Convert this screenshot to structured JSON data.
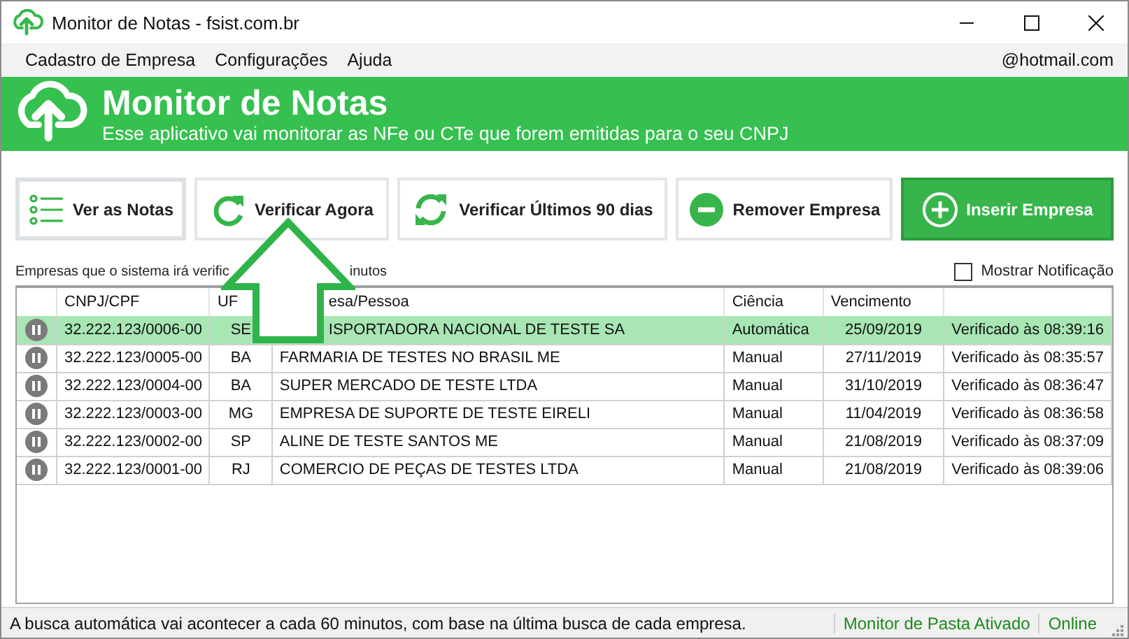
{
  "window": {
    "title": "Monitor de Notas - fsist.com.br"
  },
  "menu": {
    "items": [
      "Cadastro de Empresa",
      "Configurações",
      "Ajuda"
    ],
    "account": "@hotmail.com"
  },
  "banner": {
    "title": "Monitor de Notas",
    "subtitle": "Esse aplicativo vai monitorar as NFe ou CTe que forem emitidas para o seu CNPJ"
  },
  "buttons": [
    {
      "label": "Ver as Notas",
      "kind": "list",
      "primary": false
    },
    {
      "label": "Verificar Agora",
      "kind": "refresh",
      "primary": false
    },
    {
      "label": "Verificar Últimos 90 dias",
      "kind": "sync",
      "primary": false
    },
    {
      "label": "Remover Empresa",
      "kind": "remove",
      "primary": false
    },
    {
      "label": "Inserir Empresa",
      "kind": "insert",
      "primary": true
    }
  ],
  "list_caption": [
    "Empresas que o sistema irá verific",
    "inutos"
  ],
  "notification": {
    "label": "Mostrar Notificação",
    "checked": false
  },
  "table": {
    "columns": [
      "CNPJ/CPF",
      "UF",
      "esa/Pessoa",
      "Ciência",
      "Vencimento"
    ],
    "rows": [
      {
        "cnpj": "32.222.123/0006-00",
        "uf": "SE",
        "name": "ISPORTADORA NACIONAL DE TESTE SA",
        "ciencia": "Automática",
        "vencimento": "25/09/2019",
        "status": "Verificado às 08:39:16",
        "selected": true
      },
      {
        "cnpj": "32.222.123/0005-00",
        "uf": "BA",
        "name": "FARMARIA DE TESTES NO BRASIL ME",
        "ciencia": "Manual",
        "vencimento": "27/11/2019",
        "status": "Verificado às 08:35:57",
        "selected": false
      },
      {
        "cnpj": "32.222.123/0004-00",
        "uf": "BA",
        "name": "SUPER MERCADO DE TESTE LTDA",
        "ciencia": "Manual",
        "vencimento": "31/10/2019",
        "status": "Verificado às 08:36:47",
        "selected": false
      },
      {
        "cnpj": "32.222.123/0003-00",
        "uf": "MG",
        "name": "EMPRESA DE SUPORTE DE TESTE EIRELI",
        "ciencia": "Manual",
        "vencimento": "11/04/2019",
        "status": "Verificado às 08:36:58",
        "selected": false
      },
      {
        "cnpj": "32.222.123/0002-00",
        "uf": "SP",
        "name": "ALINE DE TESTE SANTOS ME",
        "ciencia": "Manual",
        "vencimento": "21/08/2019",
        "status": "Verificado às 08:37:09",
        "selected": false
      },
      {
        "cnpj": "32.222.123/0001-00",
        "uf": "RJ",
        "name": "COMERCIO DE PEÇAS DE TESTES LTDA",
        "ciencia": "Manual",
        "vencimento": "21/08/2019",
        "status": "Verificado às 08:39:06",
        "selected": false
      }
    ]
  },
  "status_bar": {
    "message": "A busca automática vai acontecer a cada 60 minutos, com base na última busca de cada empresa.",
    "monitor": "Monitor de Pasta Ativado",
    "connection": "Online"
  }
}
